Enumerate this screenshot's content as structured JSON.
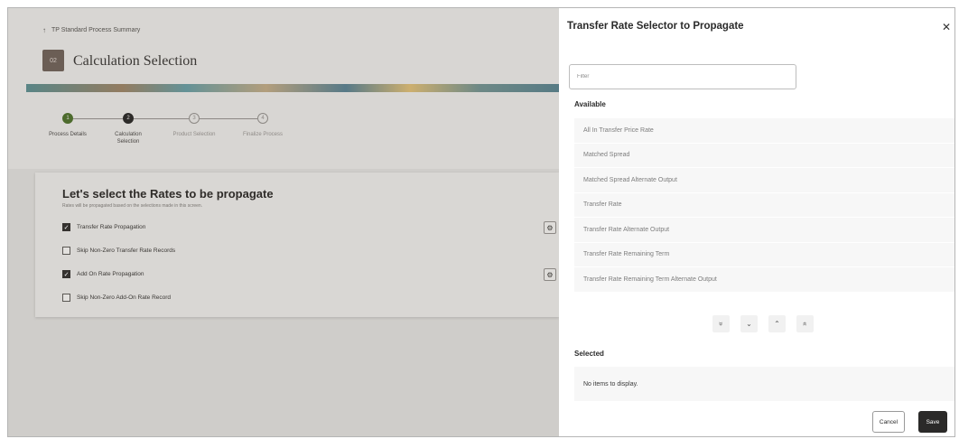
{
  "background": {
    "breadcrumb": {
      "arrow": "↑",
      "label": "TP Standard Process Summary"
    },
    "step_badge": "02",
    "page_title": "Calculation Selection",
    "train": [
      {
        "number": "1",
        "label": "Process Details",
        "state": "done"
      },
      {
        "number": "2",
        "label": "Calculation Selection",
        "state": "current"
      },
      {
        "number": "3",
        "label": "Product Selection",
        "state": "pending"
      },
      {
        "number": "4",
        "label": "Finalize Process",
        "state": "pending"
      }
    ],
    "card": {
      "title": "Let's select the Rates to be propagate",
      "subtitle": "Rates will be propagated based on the selections made in this screen.",
      "options": [
        {
          "label": "Transfer Rate Propagation",
          "checked": true,
          "has_gear": true
        },
        {
          "label": "Skip Non-Zero Transfer Rate Records",
          "checked": false,
          "has_gear": false
        },
        {
          "label": "Add On Rate Propagation",
          "checked": true,
          "has_gear": true
        },
        {
          "label": "Skip Non-Zero Add-On Rate Record",
          "checked": false,
          "has_gear": false
        }
      ]
    }
  },
  "drawer": {
    "title": "Transfer Rate Selector to Propagate",
    "close_icon": "✕",
    "filter_placeholder": "Filter",
    "available_label": "Available",
    "available_items": [
      "All In Transfer Price Rate",
      "Matched Spread",
      "Matched Spread Alternate Output",
      "Transfer Rate",
      "Transfer Rate Alternate Output",
      "Transfer Rate Remaining Term",
      "Transfer Rate Remaining Term Alternate Output"
    ],
    "controls": [
      {
        "name": "move-all-down-icon",
        "glyph": "»"
      },
      {
        "name": "move-down-icon",
        "glyph": "⌄"
      },
      {
        "name": "move-up-icon",
        "glyph": "⌃"
      },
      {
        "name": "move-all-up-icon",
        "glyph": "«"
      }
    ],
    "selected_label": "Selected",
    "selected_empty": "No items to display.",
    "cancel_label": "Cancel",
    "save_label": "Save"
  }
}
